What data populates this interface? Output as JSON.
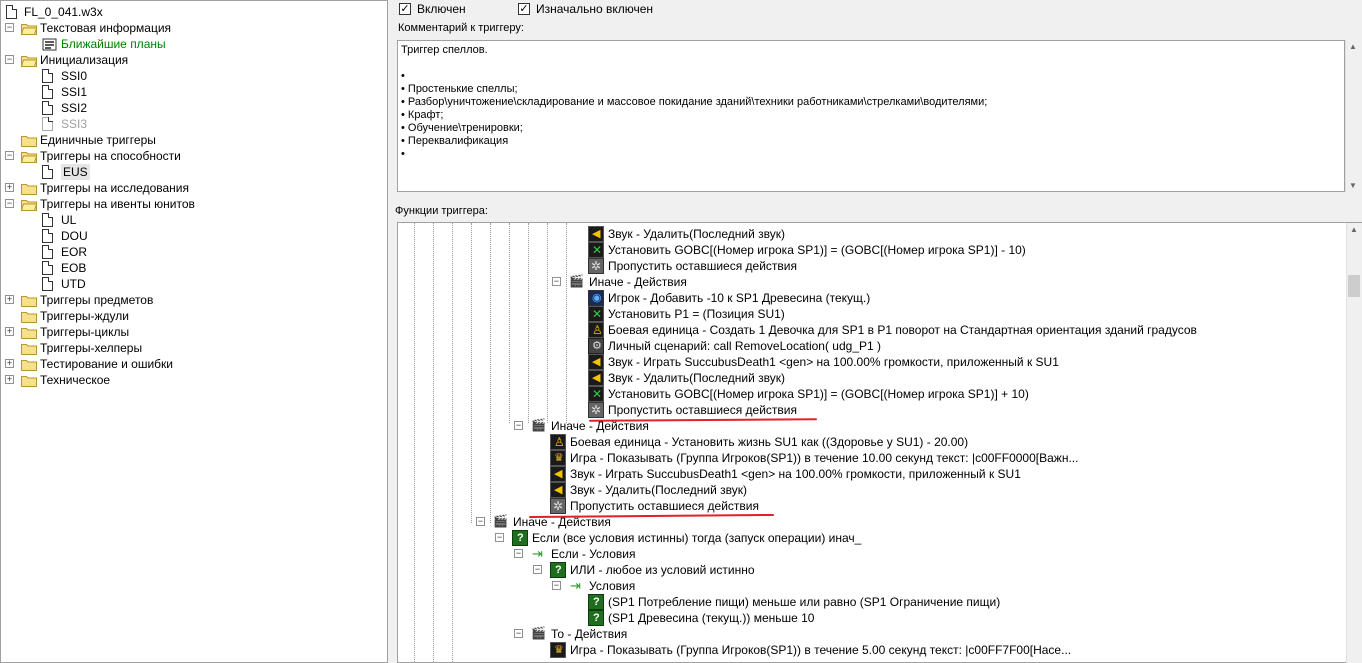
{
  "tree": {
    "root": "FL_0_041.w3x",
    "items": [
      {
        "label": "Текстовая информация"
      },
      {
        "label": "Ближайшие планы"
      },
      {
        "label": "Инициализация"
      },
      {
        "label": "SSI0"
      },
      {
        "label": "SSI1"
      },
      {
        "label": "SSI2"
      },
      {
        "label": "SSI3"
      },
      {
        "label": "Единичные триггеры"
      },
      {
        "label": "Триггеры на способности"
      },
      {
        "label": "EUS"
      },
      {
        "label": "Триггеры на исследования"
      },
      {
        "label": "Триггеры на ивенты юнитов"
      },
      {
        "label": "UL"
      },
      {
        "label": "DOU"
      },
      {
        "label": "EOR"
      },
      {
        "label": "EOB"
      },
      {
        "label": "UTD"
      },
      {
        "label": "Триггеры предметов"
      },
      {
        "label": "Триггеры-ждули"
      },
      {
        "label": "Триггеры-циклы"
      },
      {
        "label": "Триггеры-хелперы"
      },
      {
        "label": "Тестирование и ошибки"
      },
      {
        "label": "Техническое"
      }
    ]
  },
  "trigger": {
    "enabled_label": "Включен",
    "initially_enabled_label": "Изначально включен",
    "comment_label": "Комментарий к триггеру:",
    "comment_lines": [
      "Триггер спеллов.",
      "",
      "•",
      "• Простенькие спеллы;",
      "• Разбор\\уничтожение\\складирование и массовое покидание зданий\\техники работниками\\стрелками\\водителями;",
      "• Крафт;",
      "• Обучение\\тренировки;",
      "• Переквалификация",
      "•"
    ],
    "functions_label": "Функции триггера:"
  },
  "functions": [
    {
      "text": "Звук - Удалить(Последний звук)"
    },
    {
      "text": "Установить GOBC[(Номер игрока SP1)] = (GOBC[(Номер игрока SP1)] - 10)"
    },
    {
      "text": "Пропустить оставшиеся действия"
    },
    {
      "text": "Иначе - Действия"
    },
    {
      "text": "Игрок - Добавить -10 к SP1 Древесина (текущ.)"
    },
    {
      "text": "Установить P1 = (Позиция SU1)"
    },
    {
      "text": "Боевая единица - Создать 1 Девочка для SP1 в P1 поворот на Стандартная ориентация зданий градусов"
    },
    {
      "text": "Личный сценарий: call RemoveLocation( udg_P1 )"
    },
    {
      "text": "Звук - Играть SuccubusDeath1 <gen> на 100.00% громкости, приложенный к SU1"
    },
    {
      "text": "Звук - Удалить(Последний звук)"
    },
    {
      "text": "Установить GOBC[(Номер игрока SP1)] = (GOBC[(Номер игрока SP1)] + 10)"
    },
    {
      "text": "Пропустить оставшиеся действия"
    },
    {
      "text": "Иначе - Действия"
    },
    {
      "text": "Боевая единица - Установить жизнь SU1 как ((Здоровье у SU1) - 20.00)"
    },
    {
      "text": "Игра - Показывать (Группа Игроков(SP1)) в течение 10.00 секунд текст: |c00FF0000[Важн..."
    },
    {
      "text": "Звук - Играть SuccubusDeath1 <gen> на 100.00% громкости, приложенный к SU1"
    },
    {
      "text": "Звук - Удалить(Последний звук)"
    },
    {
      "text": "Пропустить оставшиеся действия"
    },
    {
      "text": "Иначе - Действия"
    },
    {
      "text": "Если (все условия истинны) тогда (запуск операции) инач_"
    },
    {
      "text": "Если - Условия"
    },
    {
      "text": "ИЛИ - любое из условий истинно"
    },
    {
      "text": "Условия"
    },
    {
      "text": "(SP1 Потребление пищи) меньше или равно (SP1 Ограничение пищи)"
    },
    {
      "text": "(SP1 Древесина (текущ.)) меньше 10"
    },
    {
      "text": "То - Действия"
    },
    {
      "text": "Игра - Показывать (Группа Игроков(SP1)) в течение 5.00 секунд текст: |c00FF7F00[Насе..."
    }
  ]
}
